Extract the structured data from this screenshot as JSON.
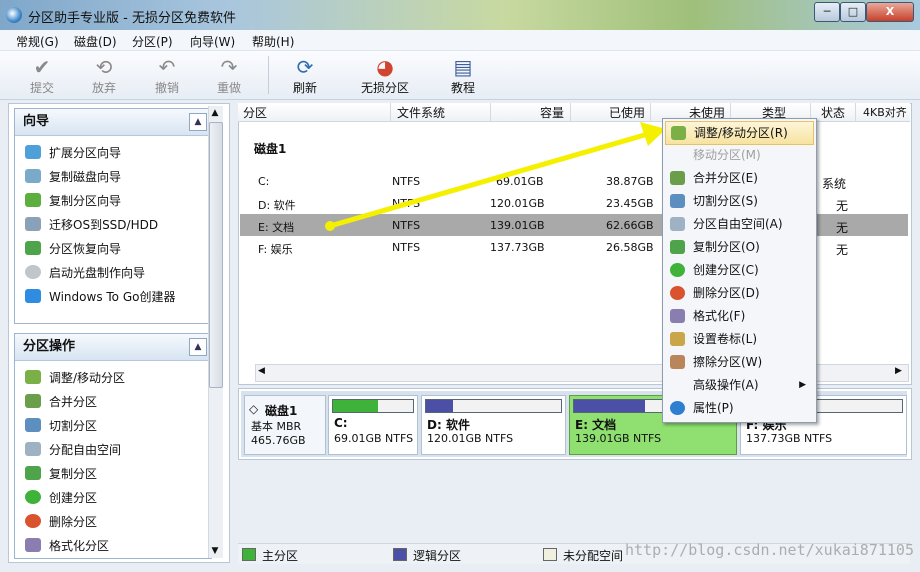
{
  "window": {
    "title": "分区助手专业版 - 无损分区免费软件",
    "minimize": "─",
    "maximize": "□",
    "close": "X"
  },
  "menubar": [
    "常规(G)",
    "磁盘(D)",
    "分区(P)",
    "向导(W)",
    "帮助(H)"
  ],
  "toolbar": {
    "submit": "提交",
    "discard": "放弃",
    "undo": "撤销",
    "redo": "重做",
    "refresh": "刷新",
    "lossless": "无损分区",
    "tutorial": "教程"
  },
  "wizard_panel": {
    "title": "向导",
    "items": [
      "扩展分区向导",
      "复制磁盘向导",
      "复制分区向导",
      "迁移OS到SSD/HDD",
      "分区恢复向导",
      "启动光盘制作向导",
      "Windows To Go创建器"
    ]
  },
  "ops_panel": {
    "title": "分区操作",
    "items": [
      "调整/移动分区",
      "合并分区",
      "切割分区",
      "分配自由空间",
      "复制分区",
      "创建分区",
      "删除分区",
      "格式化分区"
    ]
  },
  "table": {
    "headers": [
      "分区",
      "文件系统",
      "容量",
      "已使用",
      "未使用",
      "类型",
      "状态",
      "4KB对齐"
    ],
    "disk_label": "磁盘1",
    "rows": [
      {
        "name": "C:",
        "fs": "NTFS",
        "capacity": "69.01GB",
        "used": "38.87GB",
        "status": "系统"
      },
      {
        "name": "D: 软件",
        "fs": "NTFS",
        "capacity": "120.01GB",
        "used": "23.45GB",
        "status": "无"
      },
      {
        "name": "E: 文档",
        "fs": "NTFS",
        "capacity": "139.01GB",
        "used": "62.66GB",
        "status": "无"
      },
      {
        "name": "F: 娱乐",
        "fs": "NTFS",
        "capacity": "137.73GB",
        "used": "26.58GB",
        "status": "无"
      }
    ],
    "selected_row": 2
  },
  "disk_map": {
    "disk_name": "磁盘1",
    "disk_type": "基本 MBR",
    "disk_size": "465.76GB",
    "partitions": [
      {
        "name": "C:",
        "size": "69.01GB NTFS",
        "used_fraction": 0.56,
        "color": "#3fb23a"
      },
      {
        "name": "D: 软件",
        "size": "120.01GB NTFS",
        "used_fraction": 0.2,
        "color": "#4b4fa6"
      },
      {
        "name": "E: 文档",
        "size": "139.01GB NTFS",
        "used_fraction": 0.45,
        "color": "#4b4fa6"
      },
      {
        "name": "F: 娱乐",
        "size": "137.73GB NTFS",
        "used_fraction": 0.19,
        "color": "#4b4fa6"
      }
    ]
  },
  "legend": {
    "primary": "主分区",
    "logical": "逻辑分区",
    "unallocated": "未分配空间"
  },
  "watermark": "http://blog.csdn.net/xukai871105",
  "context_menu": {
    "items": [
      {
        "label": "调整/移动分区(R)",
        "icon": "resize-icon",
        "state": "highlighted"
      },
      {
        "label": "移动分区(M)",
        "icon": "move-icon",
        "state": "disabled"
      },
      {
        "label": "合并分区(E)",
        "icon": "merge-icon",
        "state": "normal"
      },
      {
        "label": "切割分区(S)",
        "icon": "split-icon",
        "state": "normal"
      },
      {
        "label": "分区自由空间(A)",
        "icon": "allocate-icon",
        "state": "normal"
      },
      {
        "label": "复制分区(O)",
        "icon": "copy-icon",
        "state": "normal"
      },
      {
        "label": "创建分区(C)",
        "icon": "create-icon",
        "state": "normal"
      },
      {
        "label": "删除分区(D)",
        "icon": "delete-icon",
        "state": "normal"
      },
      {
        "label": "格式化(F)",
        "icon": "format-icon",
        "state": "normal"
      },
      {
        "label": "设置卷标(L)",
        "icon": "label-icon",
        "state": "normal"
      },
      {
        "label": "擦除分区(W)",
        "icon": "wipe-icon",
        "state": "normal"
      },
      {
        "label": "高级操作(A)",
        "icon": "",
        "state": "submenu"
      },
      {
        "label": "属性(P)",
        "icon": "info-icon",
        "state": "normal"
      }
    ]
  },
  "colors": {
    "annotation_arrow": "#f5f000",
    "selected_row": "#a9a9a9",
    "selected_partition": "#8fe070",
    "primary_legend": "#3fb23a",
    "logical_legend": "#4b4fa6"
  }
}
